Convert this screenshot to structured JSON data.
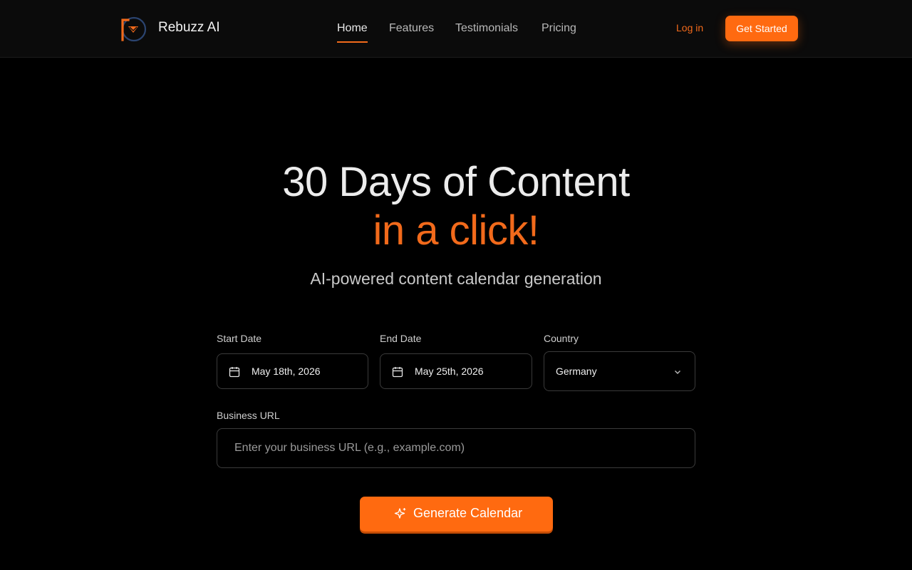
{
  "header": {
    "brand": "Rebuzz AI",
    "nav": [
      {
        "label": "Home",
        "active": true
      },
      {
        "label": "Features",
        "active": false
      },
      {
        "label": "Testimonials",
        "active": false
      },
      {
        "label": "Pricing",
        "active": false
      }
    ],
    "login_label": "Log in",
    "cta_label": "Get Started"
  },
  "hero": {
    "title": "30 Days of Content",
    "accent": "in a click!",
    "subtitle": "AI-powered content calendar generation"
  },
  "form": {
    "start_date": {
      "label": "Start Date",
      "value": "May 18th, 2026"
    },
    "end_date": {
      "label": "End Date",
      "value": "May 25th, 2026"
    },
    "country": {
      "label": "Country",
      "value": "Germany"
    },
    "business_url": {
      "label": "Business URL",
      "placeholder": "Enter your business URL (e.g., example.com)",
      "value": ""
    },
    "submit_label": "Generate Calendar"
  },
  "icons": [
    "logo-icon",
    "calendar-icon",
    "chevron-down-icon",
    "sparkle-icon"
  ],
  "colors": {
    "accent": "#f26a1b",
    "button": "#ff6a10",
    "background": "#000000",
    "header": "#0b0b0b"
  }
}
